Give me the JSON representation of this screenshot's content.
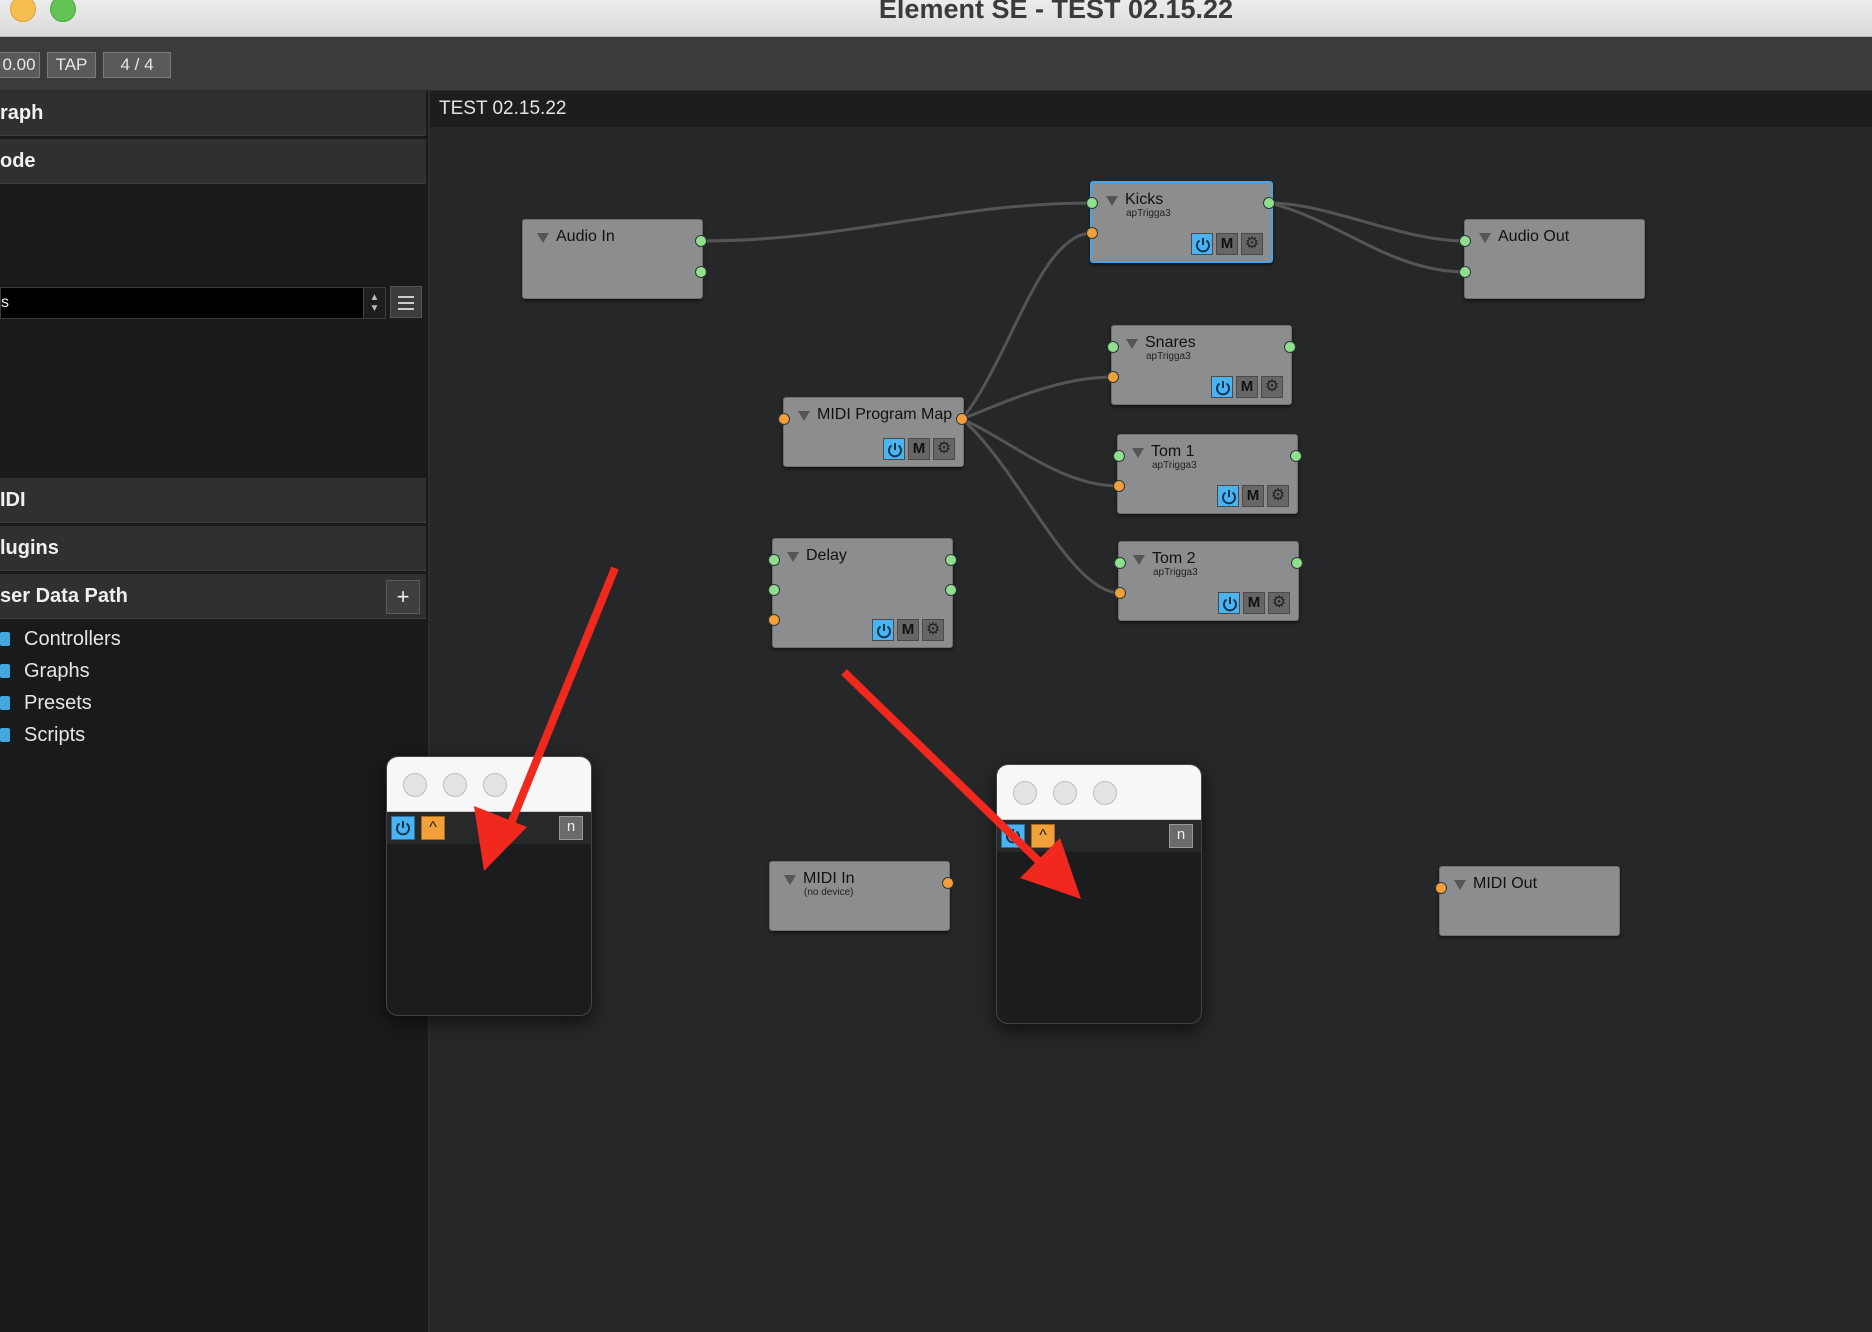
{
  "window": {
    "title": "Element SE - TEST 02.15.22"
  },
  "toolbar": {
    "tempo": "0.00",
    "tap": "TAP",
    "meter": "4 / 4"
  },
  "sidebar": {
    "sections": [
      "raph",
      "ode",
      "IDI",
      "lugins",
      "ser Data Path"
    ],
    "combo_value": "s",
    "tree_items": [
      "Controllers",
      "Graphs",
      "Presets",
      "Scripts"
    ],
    "add_label": "+"
  },
  "graph": {
    "title": "TEST 02.15.22",
    "nodes": [
      {
        "name": "Audio In",
        "subtitle": ""
      },
      {
        "name": "Kicks",
        "subtitle": "apTrigga3"
      },
      {
        "name": "Audio Out",
        "subtitle": ""
      },
      {
        "name": "Snares",
        "subtitle": "apTrigga3"
      },
      {
        "name": "MIDI Program Map",
        "subtitle": ""
      },
      {
        "name": "Tom 1",
        "subtitle": "apTrigga3"
      },
      {
        "name": "Delay",
        "subtitle": ""
      },
      {
        "name": "Tom 2",
        "subtitle": "apTrigga3"
      },
      {
        "name": "MIDI In",
        "subtitle": "(no device)"
      },
      {
        "name": "MIDI Out",
        "subtitle": ""
      }
    ],
    "node_buttons": {
      "mute": "M"
    }
  },
  "plugin_windows": [
    {
      "up_label": "^",
      "n_label": "n"
    },
    {
      "up_label": "^",
      "n_label": "n"
    }
  ],
  "colors": {
    "accent_blue": "#4ab4f2",
    "audio_port": "#8ee08f",
    "midi_port": "#f2a13a",
    "arrow": "#f0281e"
  }
}
